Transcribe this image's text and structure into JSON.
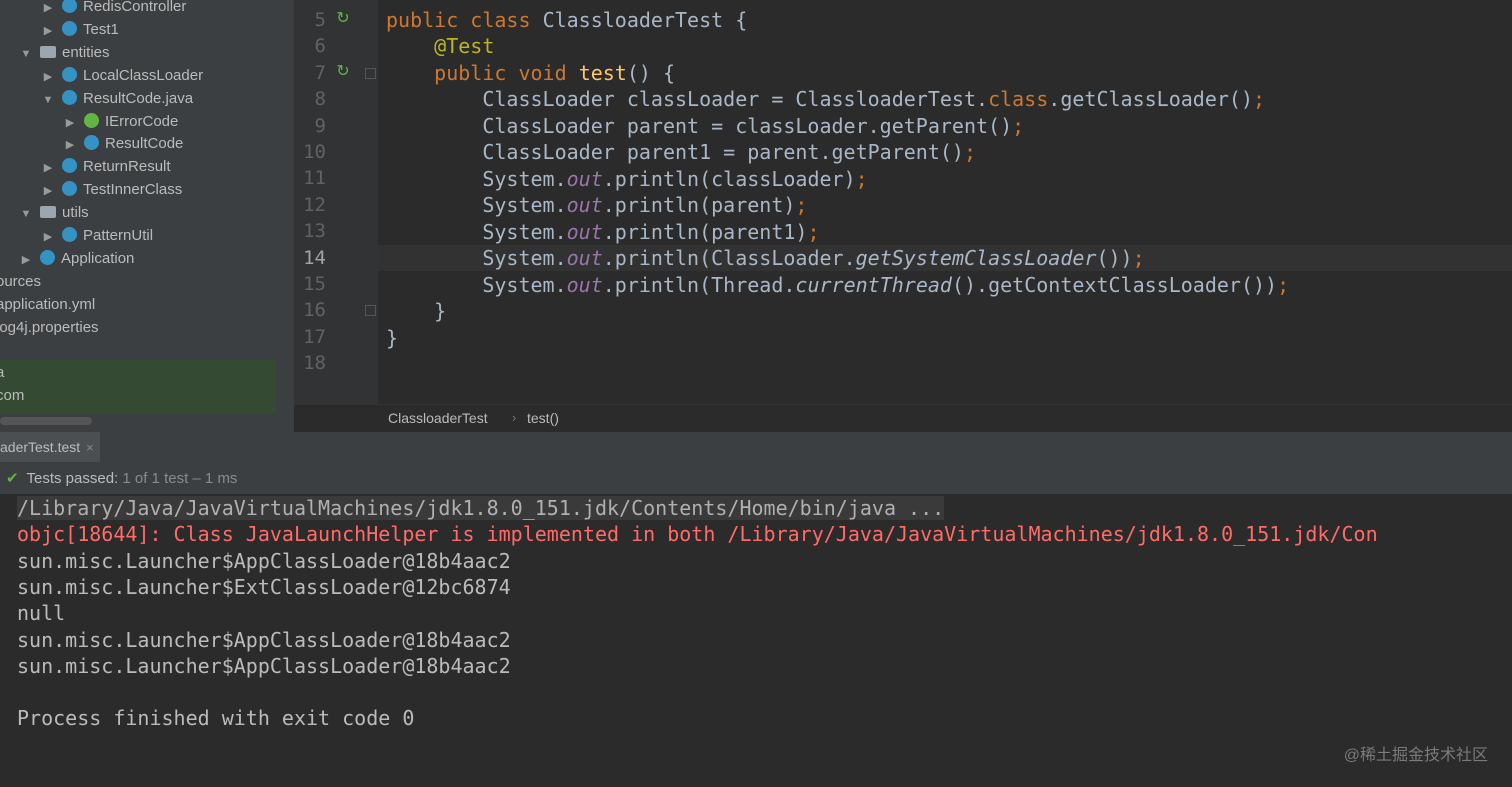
{
  "project_tree": [
    {
      "label": "RedisController",
      "icon": "class-icon",
      "indent": 1,
      "arrow": "▶"
    },
    {
      "label": "Test1",
      "icon": "class-icon",
      "indent": 1,
      "arrow": "▶"
    },
    {
      "label": "entities",
      "icon": "folder-icon",
      "indent": 0,
      "arrow": "▼"
    },
    {
      "label": "LocalClassLoader",
      "icon": "class-icon",
      "indent": 1,
      "arrow": "▶"
    },
    {
      "label": "ResultCode.java",
      "icon": "enum-icon",
      "indent": 1,
      "arrow": "▼"
    },
    {
      "label": "IErrorCode",
      "icon": "interface-icon",
      "indent": 2,
      "arrow": "▶"
    },
    {
      "label": "ResultCode",
      "icon": "enum-icon",
      "indent": 2,
      "arrow": "▶"
    },
    {
      "label": "ReturnResult",
      "icon": "class-icon",
      "indent": 1,
      "arrow": "▶"
    },
    {
      "label": "TestInnerClass",
      "icon": "class-icon",
      "indent": 1,
      "arrow": "▶"
    },
    {
      "label": "utils",
      "icon": "folder-icon",
      "indent": 0,
      "arrow": "▼"
    },
    {
      "label": "PatternUtil",
      "icon": "class-icon",
      "indent": 1,
      "arrow": "▶"
    },
    {
      "label": "Application",
      "icon": "application-icon",
      "indent": 0,
      "arrow": "▶"
    },
    {
      "label": "ources",
      "icon": "",
      "indent": -1,
      "arrow": ""
    },
    {
      "label": "application.yml",
      "icon": "",
      "indent": -1,
      "arrow": ""
    },
    {
      "label": "log4j.properties",
      "icon": "",
      "indent": -1,
      "arrow": ""
    },
    {
      "label": "",
      "icon": "",
      "indent": -1,
      "arrow": ""
    },
    {
      "label": "a",
      "icon": "",
      "indent": -1,
      "arrow": ""
    },
    {
      "label": "com",
      "icon": "",
      "indent": -1,
      "arrow": ""
    }
  ],
  "line_numbers": [
    "5",
    "6",
    "7",
    "8",
    "9",
    "10",
    "11",
    "12",
    "13",
    "14",
    "15",
    "16",
    "17",
    "18"
  ],
  "current_line": "14",
  "code": {
    "l5": {
      "kw1": "public",
      "kw2": "class",
      "name": "ClassloaderTest {"
    },
    "l6": {
      "ann": "@Test"
    },
    "l7": {
      "kw1": "public",
      "kw2": "void",
      "fn": "test",
      "rest": "() {"
    },
    "l8": {
      "a": "ClassLoader classLoader = ClassloaderTest.",
      "kw": "class",
      "b": ".getClassLoader()",
      "sc": ";"
    },
    "l9": {
      "a": "ClassLoader parent = classLoader.getParent()",
      "sc": ";"
    },
    "l10": {
      "a": "ClassLoader parent1 = parent.getParent()",
      "sc": ";"
    },
    "l11": {
      "a": "System.",
      "fld": "out",
      "b": ".println(classLoader)",
      "sc": ";"
    },
    "l12": {
      "a": "System.",
      "fld": "out",
      "b": ".println(parent)",
      "sc": ";"
    },
    "l13": {
      "a": "System.",
      "fld": "out",
      "b": ".println(parent1)",
      "sc": ";"
    },
    "l14": {
      "a": "System.",
      "fld": "out",
      "b": ".println(ClassLoader.",
      "it": "getSystemClassLoader",
      "c": "())",
      "sc": ";"
    },
    "l15": {
      "a": "System.",
      "fld": "out",
      "b": ".println(Thread.",
      "it": "currentThread",
      "c": "().getContextClassLoader())",
      "sc": ";"
    },
    "l16": {
      "a": "}"
    },
    "l17": {
      "a": "}"
    }
  },
  "breadcrumb": {
    "class": "ClassloaderTest",
    "method": "test()"
  },
  "run_tab": {
    "label": "aderTest.test",
    "close": "×"
  },
  "status": {
    "check": "✔",
    "label": "Tests passed:",
    "count": "1 of 1 test",
    "duration": "– 1 ms"
  },
  "console": [
    {
      "text": "/Library/Java/JavaVirtualMachines/jdk1.8.0_151.jdk/Contents/Home/bin/java ...",
      "kind": "cmd"
    },
    {
      "text": "objc[18644]: Class JavaLaunchHelper is implemented in both /Library/Java/JavaVirtualMachines/jdk1.8.0_151.jdk/Con",
      "kind": "err"
    },
    {
      "text": "sun.misc.Launcher$AppClassLoader@18b4aac2",
      "kind": "out"
    },
    {
      "text": "sun.misc.Launcher$ExtClassLoader@12bc6874",
      "kind": "out"
    },
    {
      "text": "null",
      "kind": "out"
    },
    {
      "text": "sun.misc.Launcher$AppClassLoader@18b4aac2",
      "kind": "out"
    },
    {
      "text": "sun.misc.Launcher$AppClassLoader@18b4aac2",
      "kind": "out"
    },
    {
      "text": "",
      "kind": "out"
    },
    {
      "text": "Process finished with exit code 0",
      "kind": "out"
    }
  ],
  "watermark": "@稀土掘金技术社区",
  "colors": {
    "keyword": "#cc7832",
    "annotation": "#bbb529",
    "function": "#ffc66d",
    "field": "#9876aa",
    "error": "#ff6b68",
    "success": "#62b543"
  }
}
